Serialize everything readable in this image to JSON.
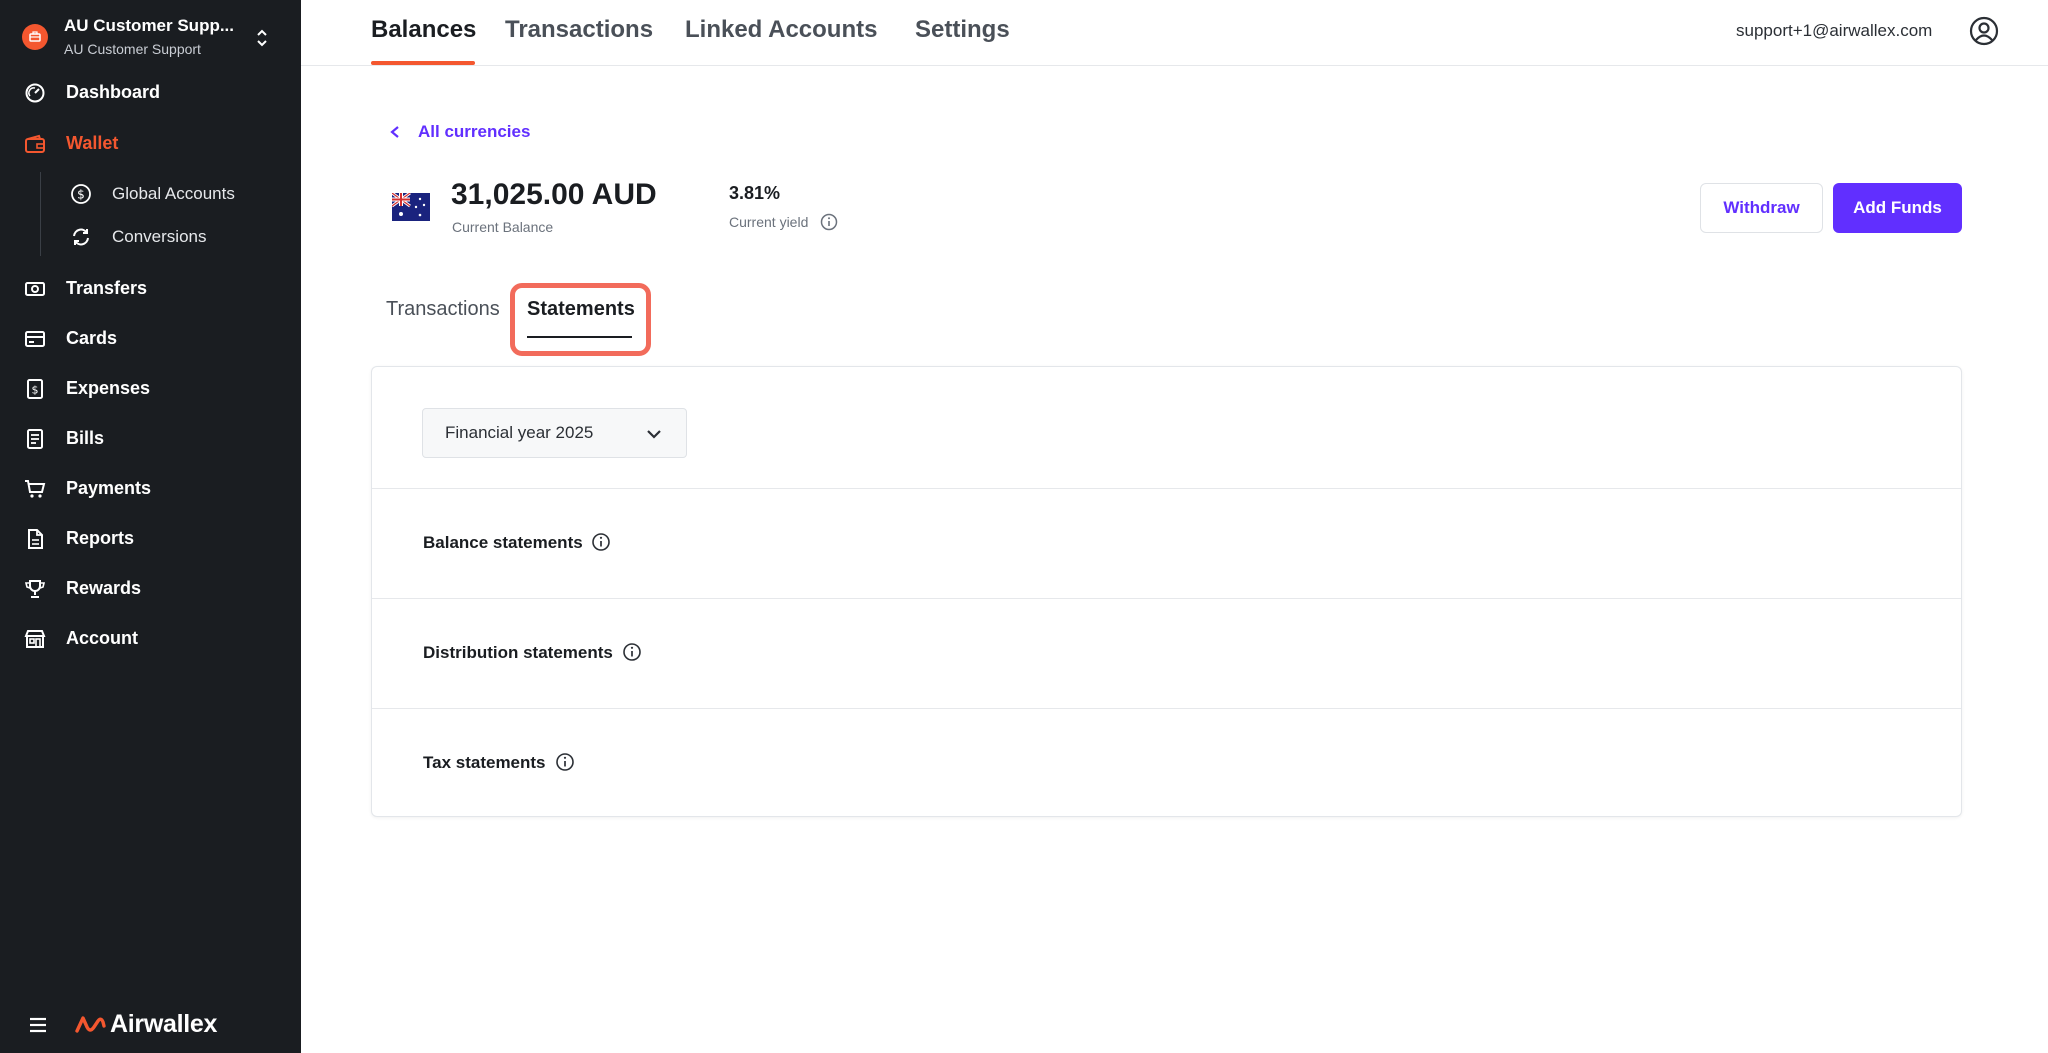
{
  "sidebar": {
    "org_name": "AU Customer Supp...",
    "org_sub": "AU Customer Support",
    "items": [
      {
        "label": "Dashboard"
      },
      {
        "label": "Wallet"
      },
      {
        "label": "Transfers"
      },
      {
        "label": "Cards"
      },
      {
        "label": "Expenses"
      },
      {
        "label": "Bills"
      },
      {
        "label": "Payments"
      },
      {
        "label": "Reports"
      },
      {
        "label": "Rewards"
      },
      {
        "label": "Account"
      }
    ],
    "wallet_sub": [
      {
        "label": "Global Accounts"
      },
      {
        "label": "Conversions"
      }
    ],
    "brand": "Airwallex",
    "accent_color": "#f4572f"
  },
  "topnav": {
    "tabs": [
      {
        "label": "Balances"
      },
      {
        "label": "Transactions"
      },
      {
        "label": "Linked Accounts"
      },
      {
        "label": "Settings"
      }
    ],
    "active_tab": "Balances",
    "user_email": "support+1@airwallex.com"
  },
  "main": {
    "back_label": "All currencies",
    "balance_amount": "31,025.00 AUD",
    "balance_label": "Current Balance",
    "yield_value": "3.81%",
    "yield_label": "Current yield",
    "withdraw_label": "Withdraw",
    "add_funds_label": "Add Funds",
    "primary_color": "#612fff",
    "subtabs": [
      {
        "label": "Transactions"
      },
      {
        "label": "Statements"
      }
    ],
    "active_subtab": "Statements",
    "year_select": "Financial year 2025",
    "statement_rows": [
      {
        "label": "Balance statements"
      },
      {
        "label": "Distribution statements"
      },
      {
        "label": "Tax statements"
      }
    ]
  }
}
